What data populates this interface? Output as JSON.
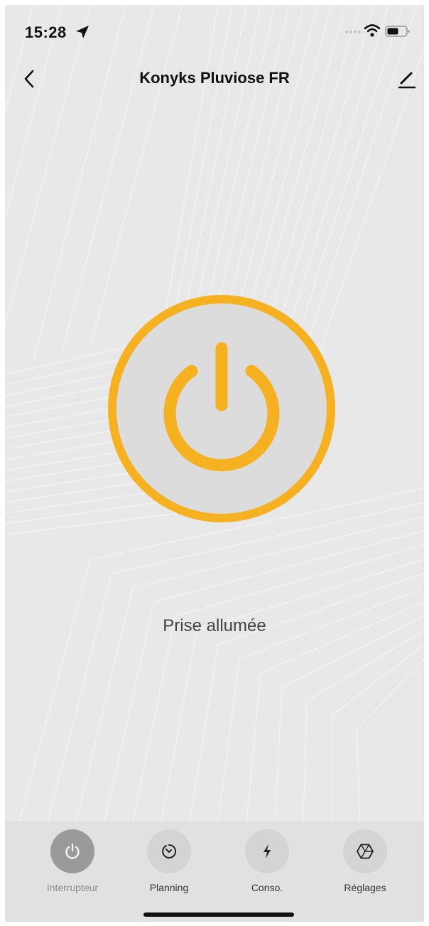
{
  "status_bar": {
    "time": "15:28",
    "location_icon": "location-arrow-icon",
    "signal_icon": "cellular-signal-icon",
    "wifi_icon": "wifi-icon",
    "battery_icon": "battery-icon"
  },
  "nav": {
    "title": "Konyks Pluviose FR",
    "back_icon": "chevron-left-icon",
    "edit_icon": "pencil-icon"
  },
  "power": {
    "icon": "power-icon",
    "state_text": "Prise allumée",
    "accent_color": "#f5b120"
  },
  "tabs": [
    {
      "label": "Interrupteur",
      "icon": "power-icon",
      "active": true
    },
    {
      "label": "Planning",
      "icon": "timer-icon",
      "active": false
    },
    {
      "label": "Conso.",
      "icon": "lightning-icon",
      "active": false
    },
    {
      "label": "Réglages",
      "icon": "settings-icon",
      "active": false
    }
  ]
}
